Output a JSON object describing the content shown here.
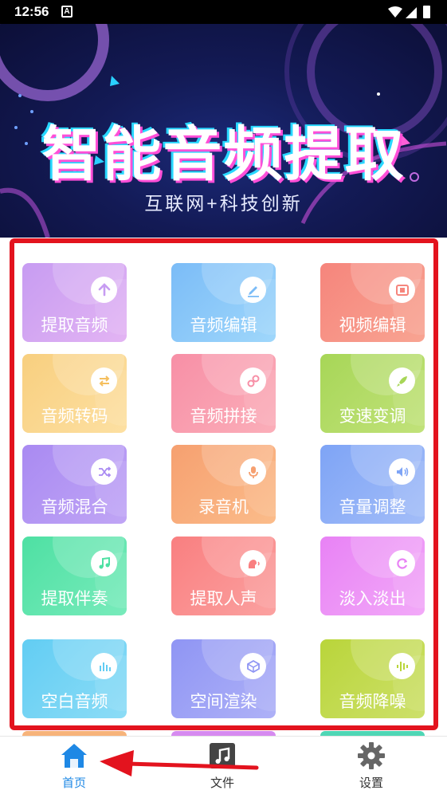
{
  "status_bar": {
    "time": "12:56",
    "notification_icon": "A"
  },
  "banner": {
    "title": "智能音频提取",
    "subtitle": "互联网+科技创新"
  },
  "tiles": [
    {
      "label": "提取音频",
      "icon": "arrow-up-icon",
      "color_from": "#c79cf2",
      "color_to": "#e3b4f3"
    },
    {
      "label": "音频编辑",
      "icon": "edit-icon",
      "color_from": "#7bbcf7",
      "color_to": "#9fd7fb"
    },
    {
      "label": "视频编辑",
      "icon": "film-icon",
      "color_from": "#f6857c",
      "color_to": "#f8a492"
    },
    {
      "label": "音频转码",
      "icon": "swap-icon",
      "color_from": "#f8cf7f",
      "color_to": "#fde0a2"
    },
    {
      "label": "音频拼接",
      "icon": "link-icon",
      "color_from": "#f78fa6",
      "color_to": "#fbaeb9"
    },
    {
      "label": "变速变调",
      "icon": "rocket-icon",
      "color_from": "#a7d657",
      "color_to": "#c1e27a"
    },
    {
      "label": "音频混合",
      "icon": "shuffle-icon",
      "color_from": "#a98af2",
      "color_to": "#c0a5f5"
    },
    {
      "label": "录音机",
      "icon": "microphone-icon",
      "color_from": "#f6a070",
      "color_to": "#fbbc8a"
    },
    {
      "label": "音量调整",
      "icon": "volume-icon",
      "color_from": "#7ea4f6",
      "color_to": "#a3bdf8"
    },
    {
      "label": "提取伴奏",
      "icon": "music-note-icon",
      "color_from": "#4ee0a3",
      "color_to": "#78ebbb"
    },
    {
      "label": "提取人声",
      "icon": "voice-icon",
      "color_from": "#f97f80",
      "color_to": "#fba1a0"
    },
    {
      "label": "淡入淡出",
      "icon": "refresh-icon",
      "color_from": "#e882f5",
      "color_to": "#f2a9f8"
    },
    {
      "label": "空白音频",
      "icon": "equalizer-icon",
      "color_from": "#62cdf3",
      "color_to": "#8cdcf6"
    },
    {
      "label": "空间渲染",
      "icon": "cube-icon",
      "color_from": "#8f95f4",
      "color_to": "#aeb1f7"
    },
    {
      "label": "音频降噪",
      "icon": "waveform-icon",
      "color_from": "#b9d53a",
      "color_to": "#cde06a"
    }
  ],
  "nav": {
    "home": {
      "label": "首页",
      "icon": "home-icon"
    },
    "files": {
      "label": "文件",
      "icon": "music-file-icon"
    },
    "settings": {
      "label": "设置",
      "icon": "gear-icon"
    }
  },
  "colors": {
    "accent": "#1e88e5",
    "highlight": "#e3131e"
  }
}
